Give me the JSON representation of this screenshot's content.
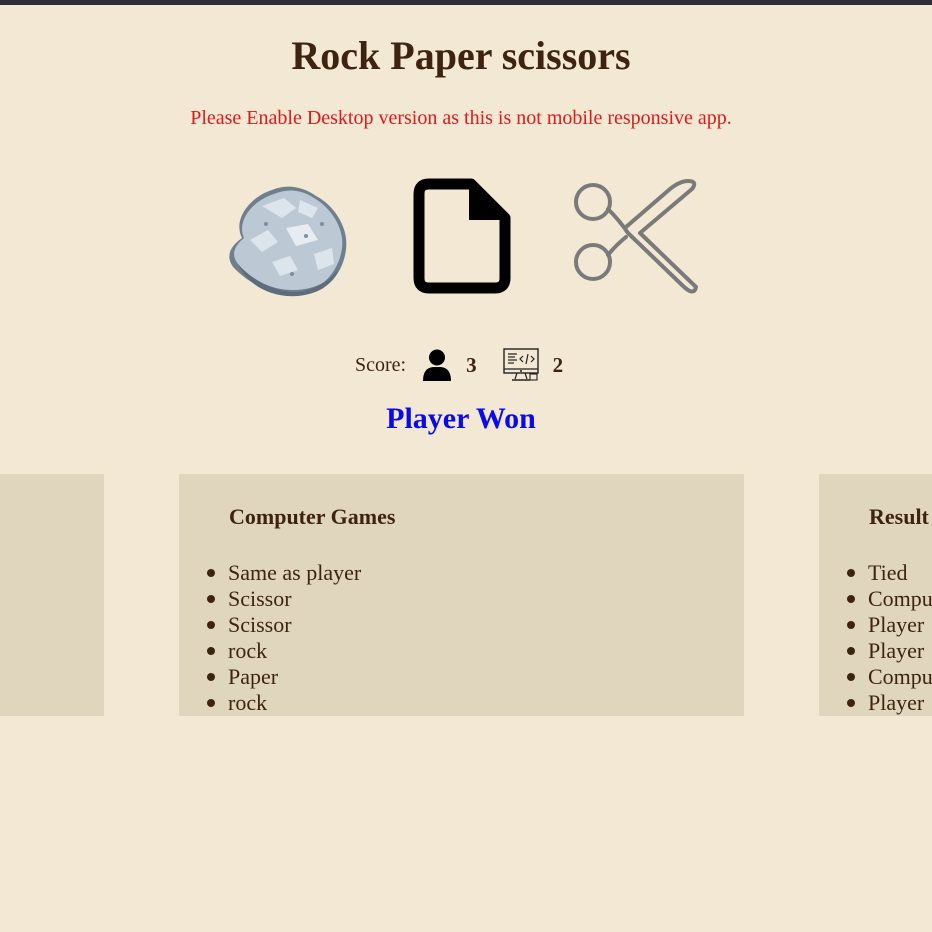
{
  "page": {
    "title": "Rock Paper scissors",
    "warning": "Please Enable Desktop version as this is not mobile responsive app."
  },
  "choices": [
    {
      "name": "rock",
      "icon": "rock-icon"
    },
    {
      "name": "paper",
      "icon": "paper-icon"
    },
    {
      "name": "scissors",
      "icon": "scissors-icon"
    }
  ],
  "score": {
    "label": "Score:",
    "player_icon": "user-icon",
    "player": "3",
    "computer_icon": "computer-icon",
    "computer": "2"
  },
  "result": {
    "text": "Player Won",
    "color": "#0a0aee"
  },
  "panels": {
    "computer": {
      "heading": "Computer Games",
      "items": [
        "Same as player",
        "Scissor",
        "Scissor",
        "rock",
        "Paper",
        "rock"
      ]
    },
    "result": {
      "heading": "Result",
      "items": [
        "Tied",
        "Computer",
        "Player",
        "Player",
        "Computer",
        "Player"
      ]
    }
  },
  "colors": {
    "background": "#f2e8d3",
    "panel": "#e0d6bd",
    "text": "#3e2410",
    "warning": "#e0191a"
  }
}
